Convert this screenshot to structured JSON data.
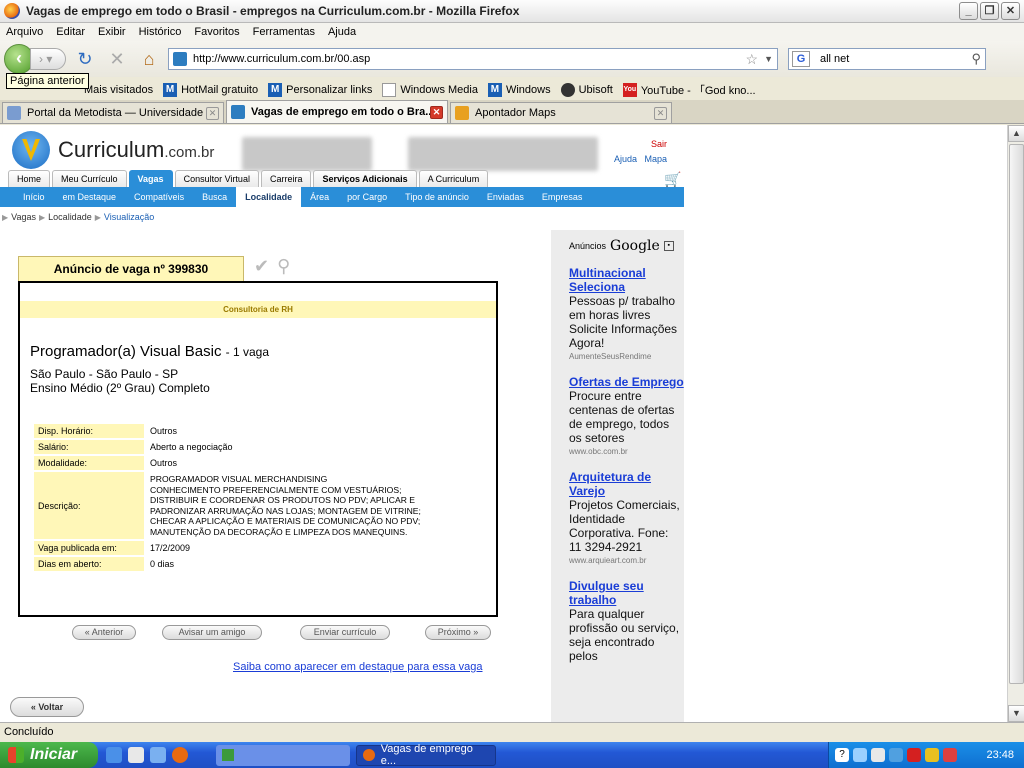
{
  "window": {
    "title": "Vagas de emprego em todo o Brasil - empregos na Curriculum.com.br - Mozilla Firefox"
  },
  "menu": [
    "Arquivo",
    "Editar",
    "Exibir",
    "Histórico",
    "Favoritos",
    "Ferramentas",
    "Ajuda"
  ],
  "nav": {
    "url": "http://www.curriculum.com.br/00.asp",
    "search_value": "all net",
    "tooltip": "Página anterior"
  },
  "bookmarks": [
    "Mais visitados",
    "HotMail gratuito",
    "Personalizar links",
    "Windows Media",
    "Windows",
    "Ubisoft",
    "YouTube - 「God kno..."
  ],
  "tabs": [
    {
      "label": "Portal da Metodista — Universidade Me..."
    },
    {
      "label": "Vagas de emprego em todo o Bra..."
    },
    {
      "label": "Apontador Maps"
    }
  ],
  "site": {
    "logo_main": "Curriculum",
    "logo_suffix": ".com.br",
    "top_links": {
      "sair": "Sair",
      "ajuda": "Ajuda",
      "mapa": "Mapa"
    },
    "main_nav": [
      "Home",
      "Meu Currículo",
      "Vagas",
      "Consultor Virtual",
      "Carreira",
      "Serviços Adicionais",
      "A Curriculum"
    ],
    "sub_nav": [
      "Início",
      "em Destaque",
      "Compatíveis",
      "Busca",
      "Localidade",
      "Área",
      "por Cargo",
      "Tipo de anúncio",
      "Enviadas",
      "Empresas"
    ],
    "breadcrumb": [
      "Vagas",
      "Localidade",
      "Visualização"
    ]
  },
  "job": {
    "tab_label": "Anúncio de vaga nº 399830",
    "company": "Consultoria de RH",
    "title": "Programador(a) Visual Basic",
    "quantity": "- 1 vaga",
    "location": "São Paulo - São Paulo - SP",
    "education": "Ensino Médio (2º Grau) Completo",
    "details": [
      {
        "key": "Disp. Horário:",
        "value": "Outros"
      },
      {
        "key": "Salário:",
        "value": "Aberto a negociação"
      },
      {
        "key": "Modalidade:",
        "value": "Outros"
      },
      {
        "key": "Descrição:",
        "value": "PROGRAMADOR VISUAL MERCHANDISING\nCONHECIMENTO PREFERENCIALMENTE COM VESTUÁRIOS;\nDISTRIBUIR E COORDENAR OS PRODUTOS NO PDV; APLICAR E\nPADRONIZAR ARRUMAÇÃO NAS LOJAS; MONTAGEM DE VITRINE;\nCHECAR A APLICAÇÃO E MATERIAIS DE COMUNICAÇÃO NO PDV;\nMANUTENÇÃO DA DECORAÇÃO E LIMPEZA DOS MANEQUINS."
      },
      {
        "key": "Vaga publicada em:",
        "value": "17/2/2009"
      },
      {
        "key": "Dias em aberto:",
        "value": "0 dias"
      }
    ],
    "buttons": {
      "anterior": "« Anterior",
      "avisar": "Avisar um amigo",
      "enviar": "Enviar currículo",
      "proximo": "Próximo »"
    },
    "destaque_link": "Saiba como aparecer em destaque para essa vaga",
    "voltar": "Voltar"
  },
  "ads": {
    "header_prefix": "Anúncios",
    "header_brand": "Google",
    "items": [
      {
        "title": "Multinacional Seleciona",
        "body": "Pessoas p/ trabalho em horas livres Solicite Informações Agora!",
        "url": "AumenteSeusRendime"
      },
      {
        "title": "Ofertas de Emprego",
        "body": "Procure entre centenas de ofertas de emprego, todos os setores",
        "url": "www.obc.com.br"
      },
      {
        "title": "Arquitetura de Varejo",
        "body": "Projetos Comerciais, Identidade Corporativa. Fone: 11 3294-2921",
        "url": "www.arquieart.com.br"
      },
      {
        "title": "Divulgue seu trabalho",
        "body": "Para qualquer profissão ou serviço, seja encontrado pelos",
        "url": ""
      }
    ]
  },
  "status": {
    "text": "Concluído"
  },
  "taskbar": {
    "start": "Iniciar",
    "task2": "Vagas de emprego e...",
    "clock": "23:48"
  },
  "colors": {
    "accent_blue": "#2a8ed8",
    "highlight_yellow": "#fff7b8"
  }
}
